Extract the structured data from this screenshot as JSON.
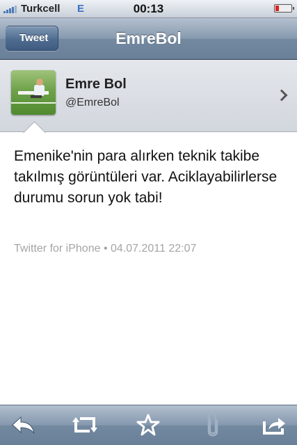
{
  "status_bar": {
    "carrier": "Turkcell",
    "network": "E",
    "time": "00:13"
  },
  "nav": {
    "back_label": "Tweet",
    "title": "EmreBol"
  },
  "profile": {
    "name": "Emre Bol",
    "handle": "@EmreBol"
  },
  "tweet": {
    "text": "Emenike'nin para alırken teknik takibe takılmış görüntüleri var. Aciklayabilirlerse durumu sorun yok tabi!",
    "meta": "Twitter for iPhone • 04.07.2011 22:07"
  },
  "toolbar": {
    "items": [
      {
        "icon": "reply-icon",
        "enabled": true
      },
      {
        "icon": "retweet-icon",
        "enabled": true
      },
      {
        "icon": "star-icon",
        "enabled": true
      },
      {
        "icon": "paperclip-icon",
        "enabled": false
      },
      {
        "icon": "share-icon",
        "enabled": true
      }
    ]
  },
  "colors": {
    "nav_blue": "#7389a0",
    "meta_gray": "#a5a5a5",
    "battery_low": "#dd2222"
  }
}
